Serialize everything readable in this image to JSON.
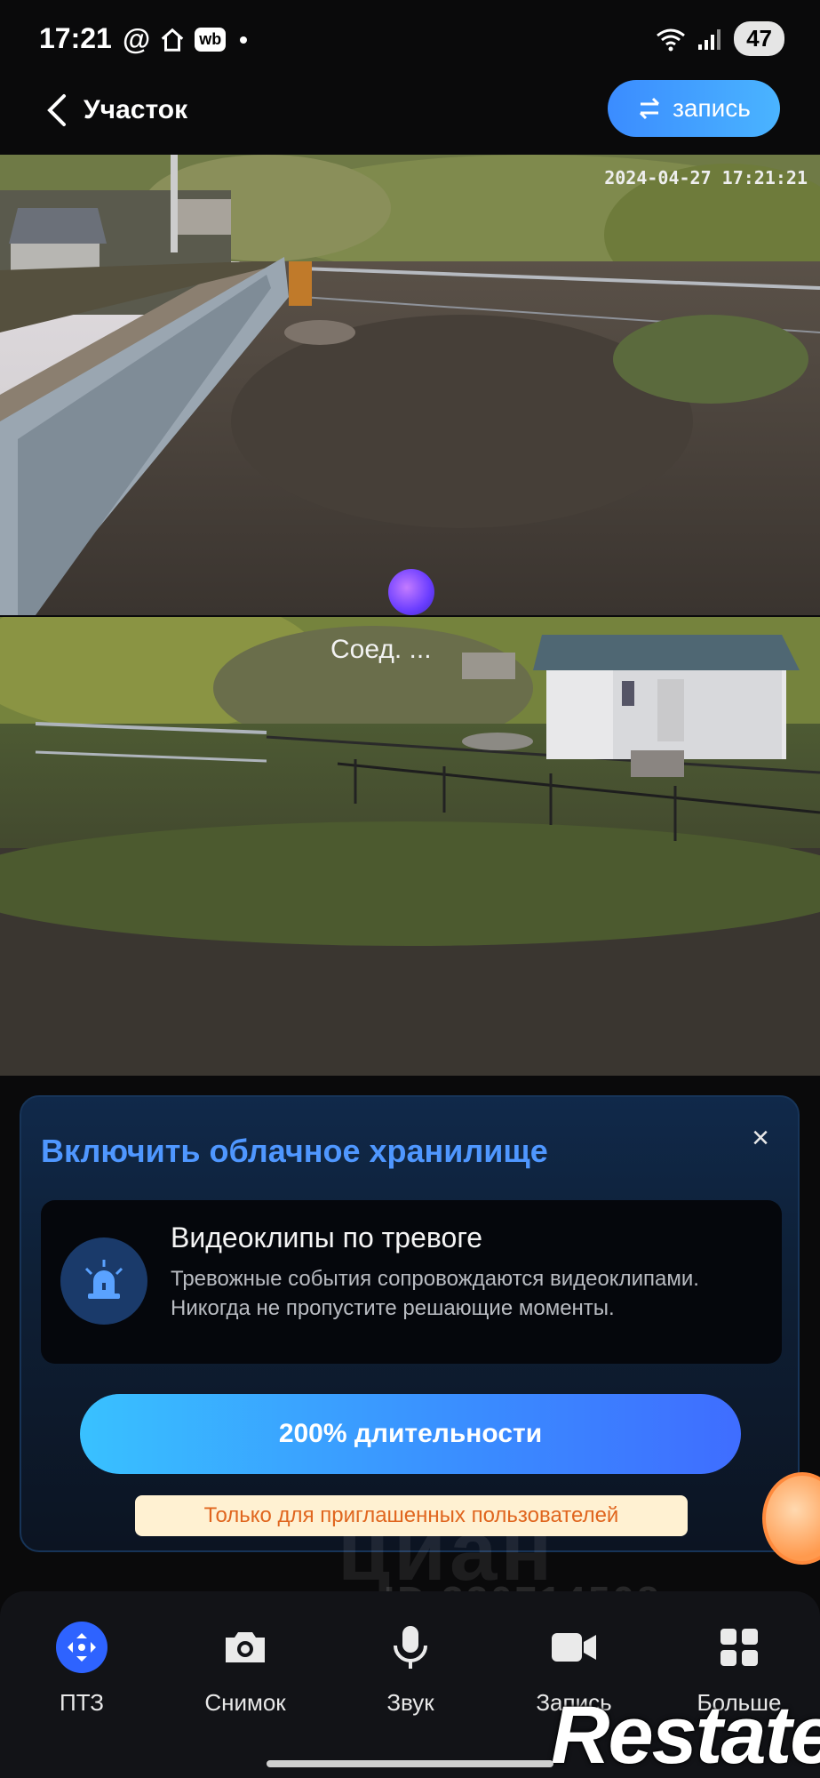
{
  "status_bar": {
    "time": "17:21",
    "at": "@",
    "wb": "wb",
    "battery": "47"
  },
  "header": {
    "back_label": "Участок",
    "record_label": "запись"
  },
  "camera1": {
    "timestamp": "2024-04-27 17:21:21"
  },
  "camera2": {
    "status": "Соед. ..."
  },
  "cloud": {
    "title": "Включить облачное хранилище",
    "close": "×",
    "feature_title": "Видеоклипы по тревоге",
    "feature_desc": "Тревожные события сопровождаются видеоклипами. Никогда не пропустите решающие моменты.",
    "cta": "200% длительности",
    "invite": "Только для приглашенных пользователей"
  },
  "watermark": {
    "brand": "циан",
    "id": "ID 330714508",
    "logo": "Restate"
  },
  "toolbar": {
    "items": [
      {
        "label": "ПТЗ",
        "icon": "ptz-icon"
      },
      {
        "label": "Снимок",
        "icon": "camera-icon"
      },
      {
        "label": "Звук",
        "icon": "microphone-icon"
      },
      {
        "label": "Запись",
        "icon": "video-icon"
      },
      {
        "label": "Больше",
        "icon": "grid-icon"
      }
    ]
  }
}
